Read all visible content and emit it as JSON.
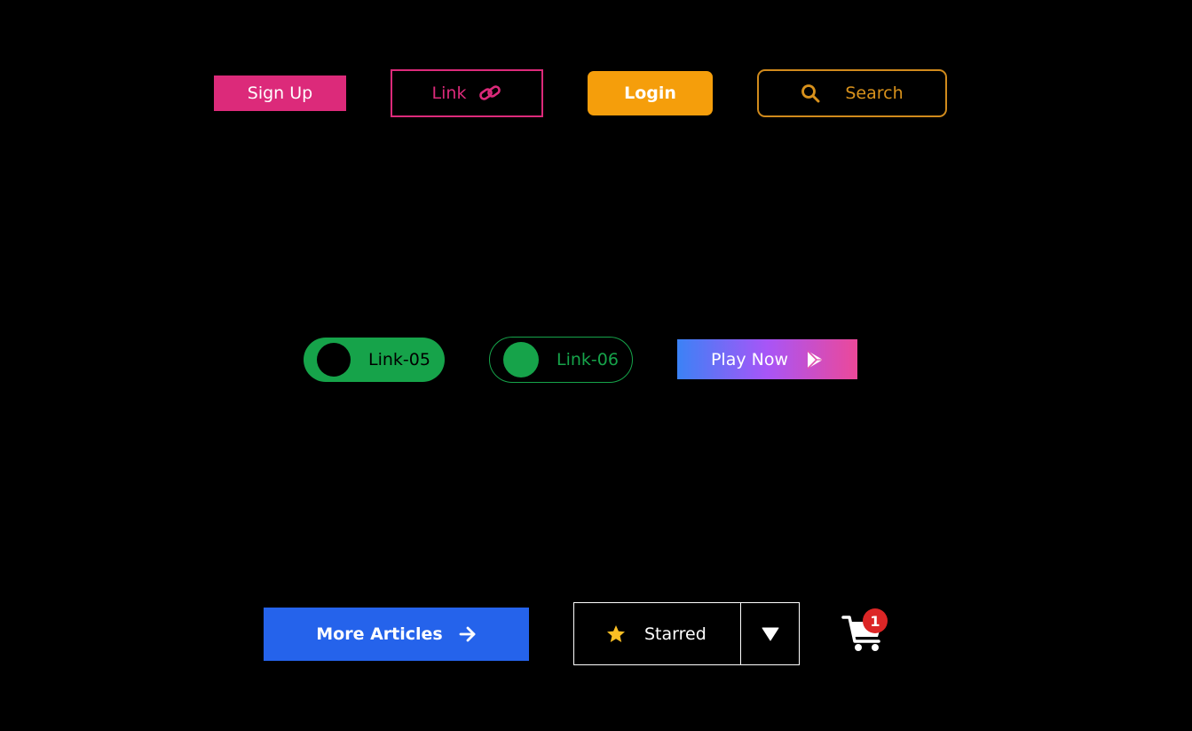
{
  "buttons": {
    "sign_up": {
      "label": "Sign Up"
    },
    "link": {
      "label": "Link",
      "icon": "link-icon"
    },
    "login": {
      "label": "Login"
    },
    "search": {
      "label": "Search",
      "icon": "search-icon"
    },
    "link_05": {
      "label": "Link-05"
    },
    "link_06": {
      "label": "Link-06"
    },
    "play_now": {
      "label": "Play Now",
      "icon": "play-store-icon"
    },
    "more_articles": {
      "label": "More Articles",
      "icon": "arrow-right-icon"
    },
    "starred": {
      "label": "Starred",
      "icon": "star-icon",
      "dropdown_icon": "triangle-down-icon"
    },
    "cart": {
      "icon": "cart-icon",
      "badge_count": "1"
    }
  },
  "colors": {
    "background": "#000000",
    "pink": "#dc2a7a",
    "amber": "#f59e0b",
    "search_outline": "#d08a1c",
    "green": "#16a34a",
    "gradient": [
      "#3b82f6",
      "#a855f7",
      "#ec4899"
    ],
    "blue": "#2563eb",
    "star": "#fbbf24",
    "badge": "#dc2626"
  }
}
